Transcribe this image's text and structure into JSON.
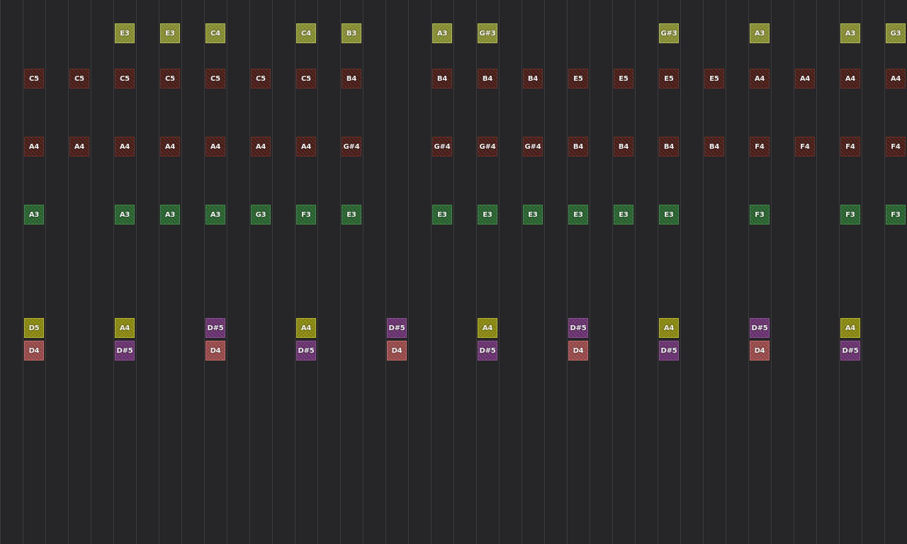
{
  "colors": {
    "lightolive": {
      "bg": "#8a9034",
      "border": "#b0b85a"
    },
    "maroon": {
      "bg": "#4a1f1a",
      "border": "#6b3028"
    },
    "green": {
      "bg": "#2a6430",
      "border": "#3f8a46"
    },
    "yellow": {
      "bg": "#8c8a12",
      "border": "#b8b630"
    },
    "purple": {
      "bg": "#6a3470",
      "border": "#8c4f94"
    },
    "rose": {
      "bg": "#9a4c4c",
      "border": "#c06a6a"
    }
  },
  "notes": [
    {
      "label": "E3",
      "color": "lightolive",
      "col": 5,
      "row": 0
    },
    {
      "label": "E3",
      "color": "lightolive",
      "col": 7,
      "row": 0
    },
    {
      "label": "C4",
      "color": "lightolive",
      "col": 9,
      "row": 0
    },
    {
      "label": "C4",
      "color": "lightolive",
      "col": 13,
      "row": 0
    },
    {
      "label": "B3",
      "color": "lightolive",
      "col": 15,
      "row": 0
    },
    {
      "label": "A3",
      "color": "lightolive",
      "col": 19,
      "row": 0
    },
    {
      "label": "G#3",
      "color": "lightolive",
      "col": 21,
      "row": 0
    },
    {
      "label": "G#3",
      "color": "lightolive",
      "col": 29,
      "row": 0
    },
    {
      "label": "A3",
      "color": "lightolive",
      "col": 33,
      "row": 0
    },
    {
      "label": "A3",
      "color": "lightolive",
      "col": 37,
      "row": 0
    },
    {
      "label": "G3",
      "color": "lightolive",
      "col": 39,
      "row": 0
    },
    {
      "label": "C5",
      "color": "maroon",
      "col": 1,
      "row": 1
    },
    {
      "label": "C5",
      "color": "maroon",
      "col": 3,
      "row": 1
    },
    {
      "label": "C5",
      "color": "maroon",
      "col": 5,
      "row": 1
    },
    {
      "label": "C5",
      "color": "maroon",
      "col": 7,
      "row": 1
    },
    {
      "label": "C5",
      "color": "maroon",
      "col": 9,
      "row": 1
    },
    {
      "label": "C5",
      "color": "maroon",
      "col": 11,
      "row": 1
    },
    {
      "label": "C5",
      "color": "maroon",
      "col": 13,
      "row": 1
    },
    {
      "label": "B4",
      "color": "maroon",
      "col": 15,
      "row": 1
    },
    {
      "label": "B4",
      "color": "maroon",
      "col": 19,
      "row": 1
    },
    {
      "label": "B4",
      "color": "maroon",
      "col": 21,
      "row": 1
    },
    {
      "label": "B4",
      "color": "maroon",
      "col": 23,
      "row": 1
    },
    {
      "label": "E5",
      "color": "maroon",
      "col": 25,
      "row": 1
    },
    {
      "label": "E5",
      "color": "maroon",
      "col": 27,
      "row": 1
    },
    {
      "label": "E5",
      "color": "maroon",
      "col": 29,
      "row": 1
    },
    {
      "label": "E5",
      "color": "maroon",
      "col": 31,
      "row": 1
    },
    {
      "label": "A4",
      "color": "maroon",
      "col": 33,
      "row": 1
    },
    {
      "label": "A4",
      "color": "maroon",
      "col": 35,
      "row": 1
    },
    {
      "label": "A4",
      "color": "maroon",
      "col": 37,
      "row": 1
    },
    {
      "label": "A4",
      "color": "maroon",
      "col": 39,
      "row": 1
    },
    {
      "label": "A4",
      "color": "maroon",
      "col": 1,
      "row": 2
    },
    {
      "label": "A4",
      "color": "maroon",
      "col": 3,
      "row": 2
    },
    {
      "label": "A4",
      "color": "maroon",
      "col": 5,
      "row": 2
    },
    {
      "label": "A4",
      "color": "maroon",
      "col": 7,
      "row": 2
    },
    {
      "label": "A4",
      "color": "maroon",
      "col": 9,
      "row": 2
    },
    {
      "label": "A4",
      "color": "maroon",
      "col": 11,
      "row": 2
    },
    {
      "label": "A4",
      "color": "maroon",
      "col": 13,
      "row": 2
    },
    {
      "label": "G#4",
      "color": "maroon",
      "col": 15,
      "row": 2
    },
    {
      "label": "G#4",
      "color": "maroon",
      "col": 19,
      "row": 2
    },
    {
      "label": "G#4",
      "color": "maroon",
      "col": 21,
      "row": 2
    },
    {
      "label": "G#4",
      "color": "maroon",
      "col": 23,
      "row": 2
    },
    {
      "label": "B4",
      "color": "maroon",
      "col": 25,
      "row": 2
    },
    {
      "label": "B4",
      "color": "maroon",
      "col": 27,
      "row": 2
    },
    {
      "label": "B4",
      "color": "maroon",
      "col": 29,
      "row": 2
    },
    {
      "label": "B4",
      "color": "maroon",
      "col": 31,
      "row": 2
    },
    {
      "label": "F4",
      "color": "maroon",
      "col": 33,
      "row": 2
    },
    {
      "label": "F4",
      "color": "maroon",
      "col": 35,
      "row": 2
    },
    {
      "label": "F4",
      "color": "maroon",
      "col": 37,
      "row": 2
    },
    {
      "label": "F4",
      "color": "maroon",
      "col": 39,
      "row": 2
    },
    {
      "label": "A3",
      "color": "green",
      "col": 1,
      "row": 3
    },
    {
      "label": "A3",
      "color": "green",
      "col": 5,
      "row": 3
    },
    {
      "label": "A3",
      "color": "green",
      "col": 7,
      "row": 3
    },
    {
      "label": "A3",
      "color": "green",
      "col": 9,
      "row": 3
    },
    {
      "label": "G3",
      "color": "green",
      "col": 11,
      "row": 3
    },
    {
      "label": "F3",
      "color": "green",
      "col": 13,
      "row": 3
    },
    {
      "label": "E3",
      "color": "green",
      "col": 15,
      "row": 3
    },
    {
      "label": "E3",
      "color": "green",
      "col": 19,
      "row": 3
    },
    {
      "label": "E3",
      "color": "green",
      "col": 21,
      "row": 3
    },
    {
      "label": "E3",
      "color": "green",
      "col": 23,
      "row": 3
    },
    {
      "label": "E3",
      "color": "green",
      "col": 25,
      "row": 3
    },
    {
      "label": "E3",
      "color": "green",
      "col": 27,
      "row": 3
    },
    {
      "label": "E3",
      "color": "green",
      "col": 29,
      "row": 3
    },
    {
      "label": "F3",
      "color": "green",
      "col": 33,
      "row": 3
    },
    {
      "label": "F3",
      "color": "green",
      "col": 37,
      "row": 3
    },
    {
      "label": "F3",
      "color": "green",
      "col": 39,
      "row": 3
    },
    {
      "label": "D5",
      "color": "yellow",
      "col": 1,
      "row": 4
    },
    {
      "label": "A4",
      "color": "yellow",
      "col": 5,
      "row": 4
    },
    {
      "label": "D#5",
      "color": "purple",
      "col": 9,
      "row": 4
    },
    {
      "label": "A4",
      "color": "yellow",
      "col": 13,
      "row": 4
    },
    {
      "label": "D#5",
      "color": "purple",
      "col": 17,
      "row": 4
    },
    {
      "label": "A4",
      "color": "yellow",
      "col": 21,
      "row": 4
    },
    {
      "label": "D#5",
      "color": "purple",
      "col": 25,
      "row": 4
    },
    {
      "label": "A4",
      "color": "yellow",
      "col": 29,
      "row": 4
    },
    {
      "label": "D#5",
      "color": "purple",
      "col": 33,
      "row": 4
    },
    {
      "label": "A4",
      "color": "yellow",
      "col": 37,
      "row": 4
    },
    {
      "label": "D4",
      "color": "rose",
      "col": 1,
      "row": 5
    },
    {
      "label": "D#5",
      "color": "purple",
      "col": 5,
      "row": 5
    },
    {
      "label": "D4",
      "color": "rose",
      "col": 9,
      "row": 5
    },
    {
      "label": "D#5",
      "color": "purple",
      "col": 13,
      "row": 5
    },
    {
      "label": "D4",
      "color": "rose",
      "col": 17,
      "row": 5
    },
    {
      "label": "D#5",
      "color": "purple",
      "col": 21,
      "row": 5
    },
    {
      "label": "D4",
      "color": "rose",
      "col": 25,
      "row": 5
    },
    {
      "label": "D#5",
      "color": "purple",
      "col": 29,
      "row": 5
    },
    {
      "label": "D4",
      "color": "rose",
      "col": 33,
      "row": 5
    },
    {
      "label": "D#5",
      "color": "purple",
      "col": 37,
      "row": 5
    }
  ]
}
